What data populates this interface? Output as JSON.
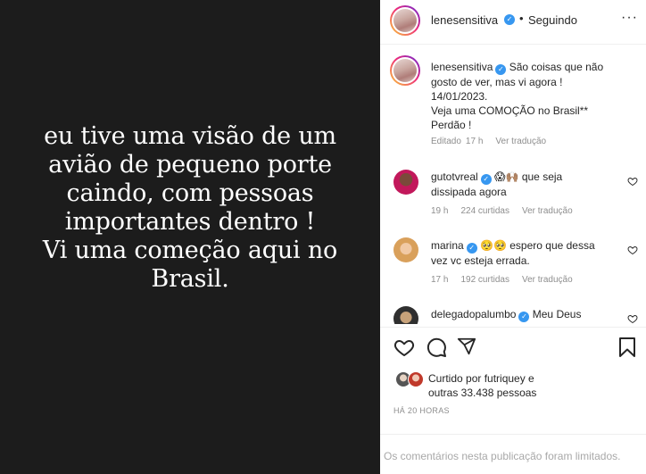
{
  "media": {
    "lines": [
      "eu tive uma visão de um",
      "avião de pequeno porte",
      "caindo, com pessoas",
      "importantes dentro !",
      "Vi uma começão aqui no",
      "Brasil."
    ]
  },
  "header": {
    "username": "lenesensitiva",
    "separator": "•",
    "follow_status": "Seguindo",
    "more": "···"
  },
  "caption": {
    "username": "lenesensitiva",
    "lines": [
      "São coisas que não",
      "gosto de ver, mas vi agora !",
      "14/01/2023.",
      "Veja uma COMOÇÃO no Brasil**",
      "Perdão !"
    ],
    "edited": "Editado",
    "age": "17 h",
    "see_translation": "Ver tradução"
  },
  "comments": [
    {
      "username": "gutotvreal",
      "line1": "😱🙌🏽 que seja",
      "line2": "dissipada agora",
      "age": "19 h",
      "likes": "224 curtidas",
      "see_translation": "Ver tradução"
    },
    {
      "username": "marina",
      "line1": "🥺🥺 espero que dessa",
      "line2": "vez vc esteja errada.",
      "age": "17 h",
      "likes": "192 curtidas",
      "see_translation": "Ver tradução"
    },
    {
      "username": "delegadopalumbo",
      "line1": "Meu Deus",
      "line2": "",
      "age": "",
      "likes": "",
      "see_translation": ""
    }
  ],
  "likes": {
    "line1": "Curtido por futriquey e",
    "line2": "outras 33.438 pessoas"
  },
  "timestamp": "HÁ 20 HORAS",
  "limited_notice": "Os comentários nesta publicação foram limitados.",
  "icons": {
    "verified": "verified-badge-icon",
    "like": "heart-icon",
    "comment": "comment-icon",
    "share": "paper-plane-icon",
    "save": "bookmark-icon",
    "more": "more-options-icon"
  },
  "colors": {
    "media_bg": "#1c1c1c",
    "verified": "#3797f0",
    "muted": "#8e8e8e",
    "text": "#262626"
  }
}
